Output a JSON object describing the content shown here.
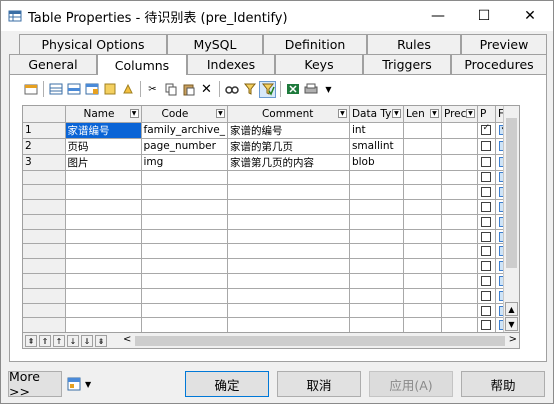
{
  "window": {
    "title": "Table Properties - 待识别表 (pre_Identify)",
    "minimize": "—",
    "maximize": "☐",
    "close": "✕"
  },
  "tabs": {
    "back": [
      "Physical Options",
      "MySQL",
      "Definition",
      "Rules",
      "Preview"
    ],
    "front": [
      "General",
      "Columns",
      "Indexes",
      "Keys",
      "Triggers",
      "Procedures"
    ],
    "active": "Columns"
  },
  "toolbar": {
    "icons": [
      "properties-icon",
      "add-row-icon",
      "insert-row-icon",
      "add-columns-icon",
      "lookup-icon",
      "clear-icon",
      "cut-icon",
      "copy-icon",
      "paste-icon",
      "delete-icon",
      "find-icon",
      "filter-icon",
      "filter-active-icon",
      "excel-icon",
      "print-icon",
      "more-dropdown-icon"
    ]
  },
  "grid": {
    "headers": [
      "Name",
      "Code",
      "Comment",
      "Data Ty",
      "Len",
      "Prec",
      "P",
      "F"
    ],
    "rows": [
      {
        "num": "1",
        "name": "家谱编号",
        "code": "family_archive_",
        "comment": "家谱的编号",
        "type": "int",
        "len": "",
        "prec": "",
        "p": true,
        "f": true
      },
      {
        "num": "2",
        "name": "页码",
        "code": "page_number",
        "comment": "家谱的第几页",
        "type": "smallint",
        "len": "",
        "prec": "",
        "p": false,
        "f": false
      },
      {
        "num": "3",
        "name": "图片",
        "code": "img",
        "comment": "家谱第几页的内容",
        "type": "blob",
        "len": "",
        "prec": "",
        "p": false,
        "f": false
      }
    ],
    "empty_rows": 12
  },
  "nav": {
    "buttons": [
      "⇞",
      "⇑",
      "↑",
      "↓",
      "⇓",
      "⇟"
    ],
    "scroll_left": "<",
    "scroll_right": ">"
  },
  "footer": {
    "more": "More >>",
    "ok": "确定",
    "cancel": "取消",
    "apply": "应用(A)",
    "help": "帮助"
  }
}
